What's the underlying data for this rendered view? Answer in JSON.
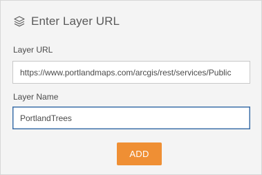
{
  "dialog": {
    "title": "Enter Layer URL",
    "icon": "layers-icon"
  },
  "layer_url": {
    "label": "Layer URL",
    "value": "https://www.portlandmaps.com/arcgis/rest/services/Public"
  },
  "layer_name": {
    "label": "Layer Name",
    "value": "PortlandTrees"
  },
  "add_button": {
    "label": "ADD",
    "color": "#ef8f34"
  },
  "colors": {
    "panel_background": "#f4f4f4",
    "focus_border": "#3c6fa8",
    "text": "#4a4a4a"
  }
}
